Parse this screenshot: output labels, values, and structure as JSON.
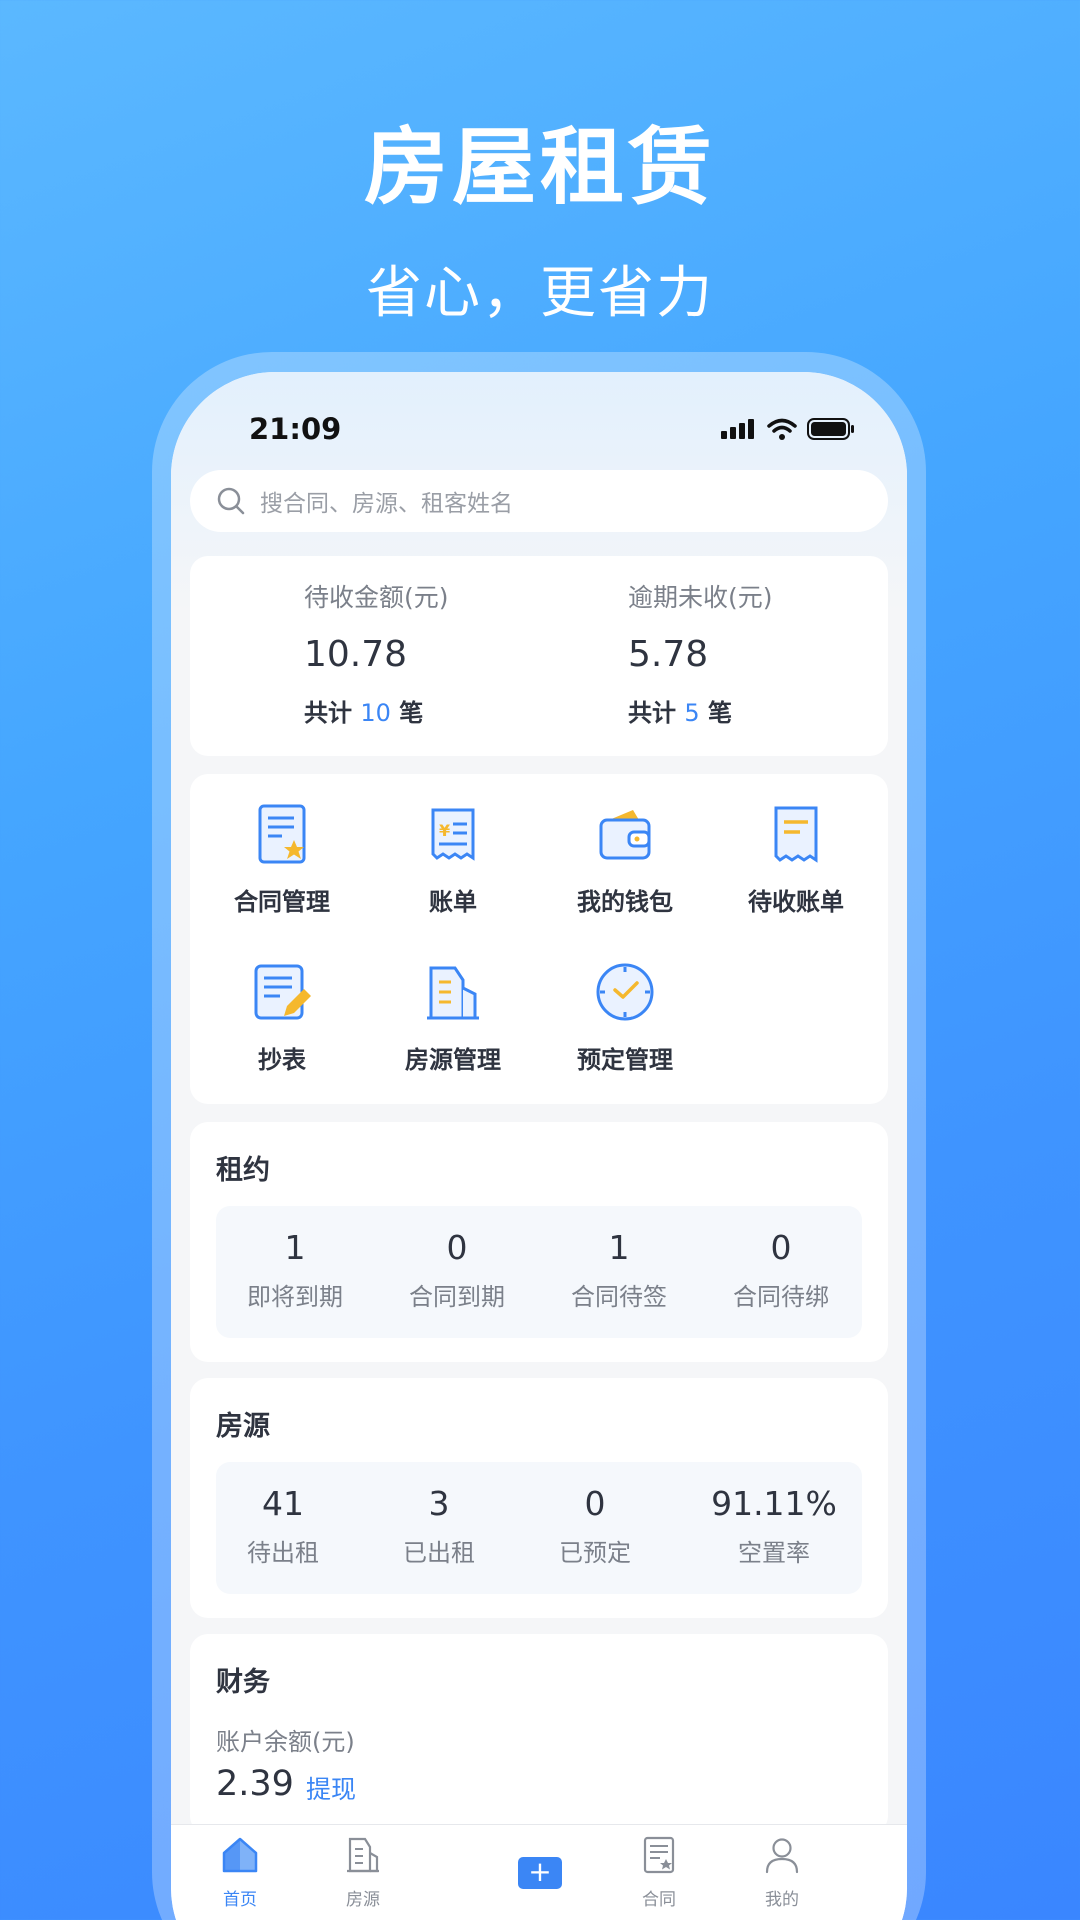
{
  "hero": {
    "title": "房屋租赁",
    "subtitle": "省心，更省力"
  },
  "status_bar": {
    "time": "21:09"
  },
  "search": {
    "placeholder": "搜合同、房源、租客姓名"
  },
  "receivable": {
    "pending": {
      "label": "待收金额(元)",
      "value": "10.78",
      "count_prefix": "共计",
      "count": "10",
      "count_suffix": "笔"
    },
    "overdue": {
      "label": "逾期未收(元)",
      "value": "5.78",
      "count_prefix": "共计",
      "count": "5",
      "count_suffix": "笔"
    }
  },
  "functions": [
    {
      "label": "合同管理",
      "icon": "contract-icon"
    },
    {
      "label": "账单",
      "icon": "bill-icon"
    },
    {
      "label": "我的钱包",
      "icon": "wallet-icon"
    },
    {
      "label": "待收账单",
      "icon": "pending-bill-icon"
    },
    {
      "label": "抄表",
      "icon": "meter-reading-icon"
    },
    {
      "label": "房源管理",
      "icon": "building-icon"
    },
    {
      "label": "预定管理",
      "icon": "clock-icon"
    }
  ],
  "lease": {
    "title": "租约",
    "stats": [
      {
        "value": "1",
        "label": "即将到期"
      },
      {
        "value": "0",
        "label": "合同到期"
      },
      {
        "value": "1",
        "label": "合同待签"
      },
      {
        "value": "0",
        "label": "合同待绑"
      }
    ]
  },
  "house": {
    "title": "房源",
    "stats": [
      {
        "value": "41",
        "label": "待出租"
      },
      {
        "value": "3",
        "label": "已出租"
      },
      {
        "value": "0",
        "label": "已预定"
      },
      {
        "value": "91.11%",
        "label": "空置率"
      }
    ]
  },
  "finance": {
    "title": "财务",
    "balance_label": "账户余额(元)",
    "balance": "2.39",
    "withdraw": "提现"
  },
  "tabs": [
    {
      "label": "首页",
      "icon": "home-icon",
      "active": true
    },
    {
      "label": "房源",
      "icon": "building-icon"
    },
    {
      "label": "",
      "icon": "plus-icon"
    },
    {
      "label": "合同",
      "icon": "contract-icon"
    },
    {
      "label": "我的",
      "icon": "person-icon"
    }
  ],
  "colors": {
    "accent": "#3b86f5",
    "hero_bg": "#45a6ff",
    "icon_blue": "#3b86f5",
    "icon_yellow": "#f5b82e"
  }
}
